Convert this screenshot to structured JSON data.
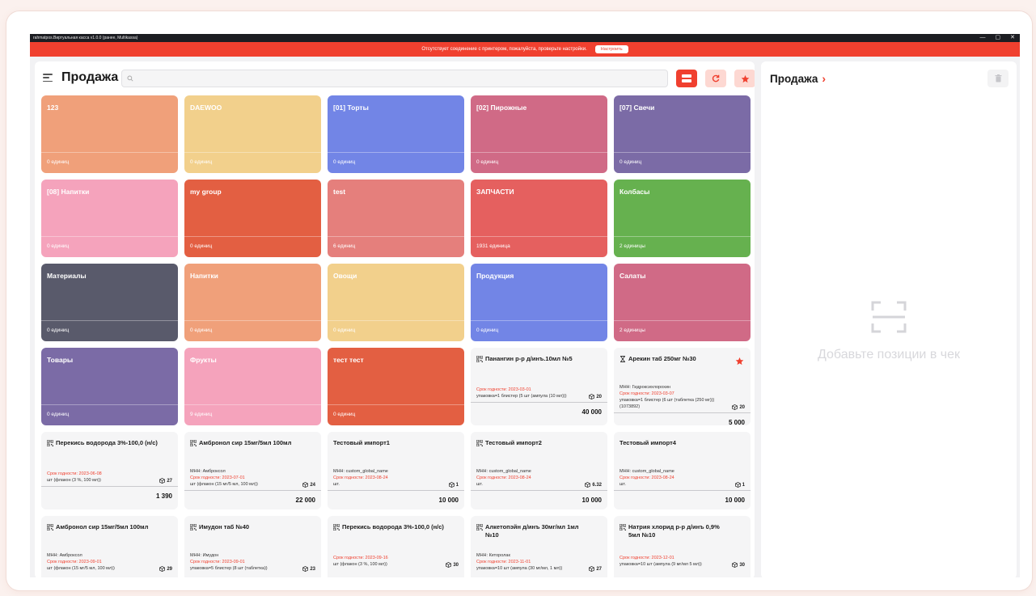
{
  "window": {
    "title": "rahmatpos.Виртуальная касса v1.0.0 (ранее, Multikassa)",
    "controls": [
      "—",
      "▢",
      "✕"
    ]
  },
  "alert": {
    "message": "Отсутствует соединение с принтером, пожалуйста, проверьте настройки.",
    "button_label": "Настроить"
  },
  "header": {
    "title": "Продажа",
    "search_value": "",
    "search_placeholder": ""
  },
  "groups": [
    {
      "name": "123",
      "count": "0 единиц",
      "color": "#f0a07a"
    },
    {
      "name": "DAEWOO",
      "count": "0 единиц",
      "color": "#f2d08c"
    },
    {
      "name": "[01] Торты",
      "count": "0 единиц",
      "color": "#7285e6"
    },
    {
      "name": "[02] Пирожные",
      "count": "0 единиц",
      "color": "#d06a86"
    },
    {
      "name": "[07] Свечи",
      "count": "0 единиц",
      "color": "#7b6ba6"
    },
    {
      "name": "[08] Напитки",
      "count": "0 единиц",
      "color": "#f5a3bc"
    },
    {
      "name": "my group",
      "count": "0 единиц",
      "color": "#e35f42"
    },
    {
      "name": "test",
      "count": "6 единиц",
      "color": "#e57f7c"
    },
    {
      "name": "ЗАПЧАСТИ",
      "count": "1931 единица",
      "color": "#e5605f"
    },
    {
      "name": "Колбасы",
      "count": "2 единицы",
      "color": "#66b14f"
    },
    {
      "name": "Материалы",
      "count": "0 единиц",
      "color": "#595a6b"
    },
    {
      "name": "Напитки",
      "count": "0 единиц",
      "color": "#f0a07a"
    },
    {
      "name": "Овощи",
      "count": "0 единиц",
      "color": "#f2d08c"
    },
    {
      "name": "Продукция",
      "count": "0 единиц",
      "color": "#7285e6"
    },
    {
      "name": "Салаты",
      "count": "2 единицы",
      "color": "#d06a86"
    },
    {
      "name": "Товары",
      "count": "0 единиц",
      "color": "#7b6ba6"
    },
    {
      "name": "Фрукты",
      "count": "9 единиц",
      "color": "#f5a3bc"
    },
    {
      "name": "тест тест",
      "count": "0 единиц",
      "color": "#e35f42"
    }
  ],
  "products": [
    {
      "icon": "qr",
      "name": "Панангин р-р д/инъ.10мл №5",
      "mnn": "",
      "expiry": "Срок годности: 2023-03-01",
      "pack": "упаковка=1 блистер (5 шт (ампула (10 мл)))",
      "code": "",
      "qty": "20",
      "price": "40 000",
      "fav": false
    },
    {
      "icon": "hourglass",
      "name": "Арекин таб 250мг №30",
      "mnn": "МНН: Гидроксихлорохин",
      "expiry": "Срок годности: 2023-03-07",
      "pack": "упаковка=1 блистер (6 шт (таблетка (250 мг)))",
      "code": "(1073892)",
      "qty": "20",
      "price": "5 000",
      "fav": true
    },
    {
      "icon": "qr",
      "name": "Перекись водорода 3%-100,0 (н/с)",
      "mnn": "",
      "expiry": "Срок годности: 2023-06-08",
      "pack": "шт (флакон (3 %, 100 мл))",
      "code": "",
      "qty": "27",
      "price": "1 390",
      "fav": false
    },
    {
      "icon": "qr",
      "name": "Амбронол сир 15мг/5мл 100мл",
      "mnn": "МНН: Амброксол",
      "expiry": "Срок годности: 2023-07-01",
      "pack": "шт (флакон (15 мг/5 мл, 100 мл))",
      "code": "",
      "qty": "24",
      "price": "22 000",
      "fav": false
    },
    {
      "icon": "",
      "name": "Тестовый импорт1",
      "mnn": "МНН: custom_global_name",
      "expiry": "Срок годности: 2023-08-24",
      "pack": "шт.",
      "code": "",
      "qty": "1",
      "price": "10 000",
      "fav": false
    },
    {
      "icon": "qr",
      "name": "Тестовый импорт2",
      "mnn": "МНН: custom_global_name",
      "expiry": "Срок годности: 2023-08-24",
      "pack": "шт.",
      "code": "",
      "qty": "6.32",
      "price": "10 000",
      "fav": false
    },
    {
      "icon": "",
      "name": "Тестовый импорт4",
      "mnn": "МНН: custom_global_name",
      "expiry": "Срок годности: 2023-08-24",
      "pack": "шт.",
      "code": "",
      "qty": "1",
      "price": "10 000",
      "fav": false
    },
    {
      "icon": "qr",
      "name": "Амбронол сир 15мг/5мл 100мл",
      "mnn": "МНН: Амброксол",
      "expiry": "Срок годности: 2023-09-01",
      "pack": "шт (флакон (15 мг/5 мл, 100 мл))",
      "code": "",
      "qty": "29",
      "price": "",
      "fav": false
    },
    {
      "icon": "qr",
      "name": "Имудон таб №40",
      "mnn": "МНН: Имудон",
      "expiry": "Срок годности: 2023-09-01",
      "pack": "упаковка=5 блистер (8 шт (таблетка))",
      "code": "",
      "qty": "23",
      "price": "",
      "fav": false
    },
    {
      "icon": "qr",
      "name": "Перекись водорода 3%-100,0 (н/с)",
      "mnn": "",
      "expiry": "Срок годности: 2023-09-16",
      "pack": "шт (флакон (3 %, 100 мл))",
      "code": "",
      "qty": "30",
      "price": "",
      "fav": false
    },
    {
      "icon": "qr",
      "name": "Алкетопэйн д/инъ 30мг/мл 1мл №10",
      "mnn": "МНН: Кеторолак",
      "expiry": "Срок годности: 2023-11-01",
      "pack": "упаковка=10 шт (ампула (30 мг/мл, 1 мл))",
      "code": "",
      "qty": "27",
      "price": "",
      "fav": false
    },
    {
      "icon": "qr",
      "name": "Натрия хлорид р-р д/инъ 0,9% 5мл №10",
      "mnn": "",
      "expiry": "Срок годности: 2023-12-01",
      "pack": "упаковка=10 шт (ампула (9 мг/мл 5 мл))",
      "code": "",
      "qty": "30",
      "price": "",
      "fav": false
    }
  ],
  "cart": {
    "title": "Продажа",
    "empty_text": "Добавьте позиции в чек"
  },
  "colors": {
    "accent": "#f0402f",
    "accent_soft": "#fdd8d2"
  },
  "icons": {
    "menu": "hamburger-icon",
    "search": "search-icon",
    "layout": "layout-toggle-icon",
    "refresh": "refresh-icon",
    "favorites": "star-icon",
    "trash": "trash-icon",
    "scanner": "barcode-scan-icon"
  }
}
